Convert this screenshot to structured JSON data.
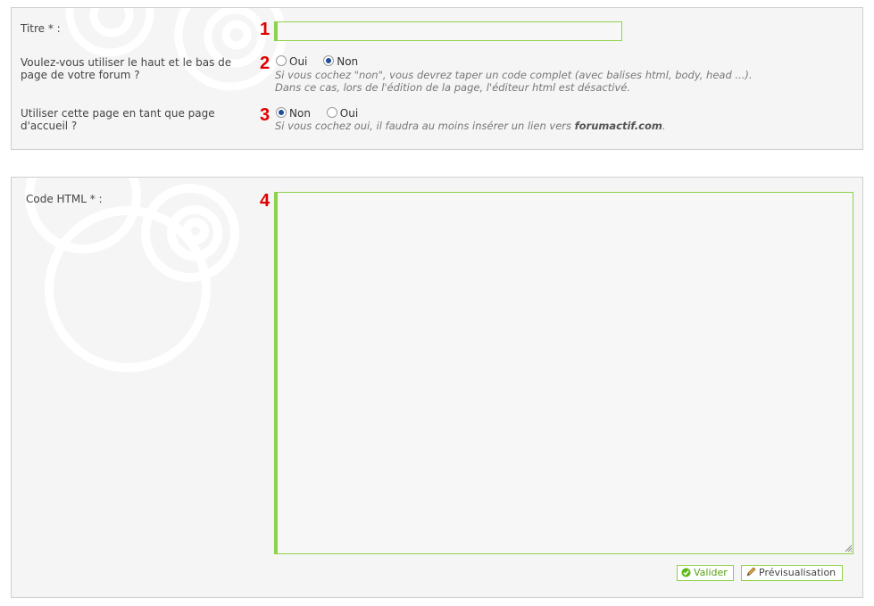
{
  "panel1": {
    "titre": {
      "label": "Titre * :",
      "number": "1",
      "value": ""
    },
    "header_footer": {
      "label_line1": "Voulez-vous utiliser le haut et le bas de",
      "label_line2": "page de votre forum ?",
      "number": "2",
      "options": [
        {
          "label": "Oui",
          "checked": false
        },
        {
          "label": "Non",
          "checked": true
        }
      ],
      "hint_line1": "Si vous cochez \"non\", vous devrez taper un code complet (avec balises html, body, head ...).",
      "hint_line2": "Dans ce cas, lors de l'édition de la page, l'éditeur html est désactivé."
    },
    "homepage": {
      "label_line1": "Utiliser cette page en tant que page",
      "label_line2": "d'accueil ?",
      "number": "3",
      "options": [
        {
          "label": "Non",
          "checked": true
        },
        {
          "label": "Oui",
          "checked": false
        }
      ],
      "hint_prefix": "Si vous cochez oui, il faudra au moins insérer un lien vers ",
      "hint_link": "forumactif.com",
      "hint_suffix": "."
    }
  },
  "panel2": {
    "code": {
      "label": "Code HTML * :",
      "number": "4",
      "value": ""
    },
    "buttons": {
      "submit": "Valider",
      "preview": "Prévisualisation"
    }
  },
  "colors": {
    "accent": "#8fd14a",
    "number": "#e00000",
    "panel_bg": "#f5f5f5"
  },
  "icons": {
    "submit": "check-circle-icon",
    "preview": "pencil-icon"
  }
}
